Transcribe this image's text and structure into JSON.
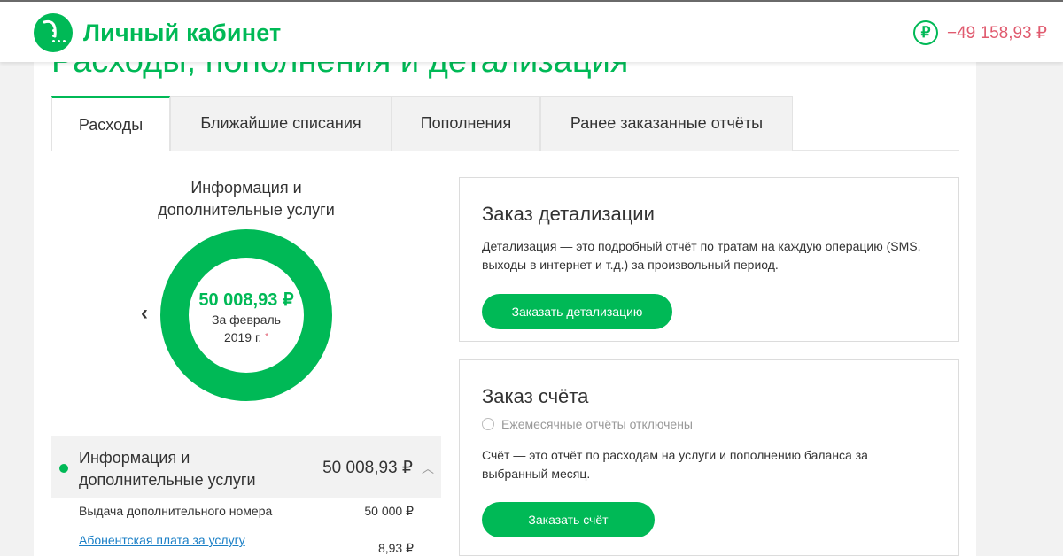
{
  "header": {
    "brand": "Личный кабинет",
    "currency_symbol": "₽",
    "balance": "−49 158,93 ₽"
  },
  "page": {
    "title": "Расходы, пополнения и детализация"
  },
  "tabs": [
    {
      "label": "Расходы",
      "active": true
    },
    {
      "label": "Ближайшие списания",
      "active": false
    },
    {
      "label": "Пополнения",
      "active": false
    },
    {
      "label": "Ранее заказанные отчёты",
      "active": false
    }
  ],
  "donut": {
    "title_line1": "Информация и",
    "title_line2": "дополнительные услуги",
    "amount": "50 008,93 ₽",
    "period_line1": "За февраль",
    "period_line2": "2019 г.",
    "footnote_mark": "*",
    "share": 1.0,
    "color": "#00b956",
    "prev_icon": "chevron-left-icon"
  },
  "category": {
    "name_line1": "Информация и",
    "name_line2": "дополнительные услуги",
    "amount": "50 008,93 ₽",
    "items": [
      {
        "label": "Выдача дополнительного номера",
        "amount": "50 000 ₽",
        "link": false
      },
      {
        "label": "Абонентская плата за услугу",
        "amount": "8,93 ₽",
        "link": true
      }
    ]
  },
  "detail_card": {
    "title": "Заказ детализации",
    "text": "Детализация — это подробный отчёт по тратам на каждую операцию (SMS, выходы в интернет и т.д.) за произвольный период.",
    "button": "Заказать детализацию"
  },
  "invoice_card": {
    "title": "Заказ счёта",
    "radio_label": "Ежемесячные отчёты отключены",
    "text": "Счёт — это отчёт по расходам на услуги и пополнению баланса за выбранный месяц.",
    "button": "Заказать счёт"
  },
  "colors": {
    "brand": "#00b956",
    "negative": "#e05a6e",
    "link": "#1a7fc6"
  }
}
